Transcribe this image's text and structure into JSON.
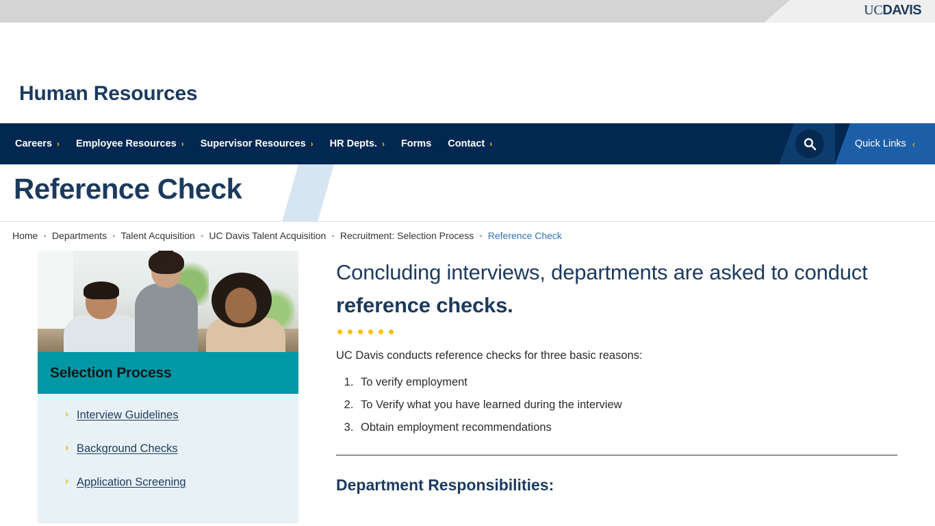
{
  "topbar": {
    "logo_uc": "UC",
    "logo_davis": "DAVIS"
  },
  "header": {
    "site_title": "Human Resources"
  },
  "nav": {
    "items": [
      {
        "label": "Careers",
        "chevron": "›",
        "has_chevron": true
      },
      {
        "label": "Employee Resources",
        "chevron": "›",
        "has_chevron": true
      },
      {
        "label": "Supervisor Resources",
        "chevron": "›",
        "has_chevron": true
      },
      {
        "label": "HR Depts.",
        "chevron": "›",
        "has_chevron": true
      },
      {
        "label": "Forms",
        "chevron": "",
        "has_chevron": false
      },
      {
        "label": "Contact",
        "chevron": "›",
        "has_chevron": true
      }
    ],
    "search_icon": "search-icon",
    "quick_links_label": "Quick Links",
    "quick_links_chevron": "‹"
  },
  "page": {
    "title": "Reference Check"
  },
  "breadcrumb": {
    "separator": "•",
    "items": [
      {
        "label": "Home",
        "current": false
      },
      {
        "label": "Departments",
        "current": false
      },
      {
        "label": "Talent Acquisition",
        "current": false
      },
      {
        "label": "UC Davis Talent Acquisition",
        "current": false
      },
      {
        "label": "Recruitment: Selection Process",
        "current": false
      },
      {
        "label": "Reference Check",
        "current": true
      }
    ]
  },
  "sidebar": {
    "photo_alt": "three colleagues reviewing work together at a desk",
    "heading": "Selection Process",
    "links": [
      {
        "label": "Interview Guidelines",
        "chevron": "›"
      },
      {
        "label": "Background Checks",
        "chevron": "›"
      },
      {
        "label": "Application Screening",
        "chevron": "›"
      }
    ]
  },
  "main": {
    "lede_plain": "Concluding interviews, departments are asked to conduct ",
    "lede_bold": "reference checks.",
    "dots_count": 6,
    "intro": "UC Davis conducts reference checks for three basic reasons:",
    "reasons": [
      "To verify employment",
      "To Verify what you have learned during the interview",
      "Obtain employment recommendations"
    ],
    "sub_heading": "Department Responsibilities:"
  },
  "colors": {
    "navy": "#022851",
    "navy_text": "#1c3a5e",
    "gold": "#ffbf00",
    "teal": "#0098a6",
    "link_blue": "#3070b3",
    "quicklinks_blue": "#1c5fa8",
    "sidebar_bg": "#e8f1f5",
    "topbar_gray": "#d4d4d4"
  }
}
